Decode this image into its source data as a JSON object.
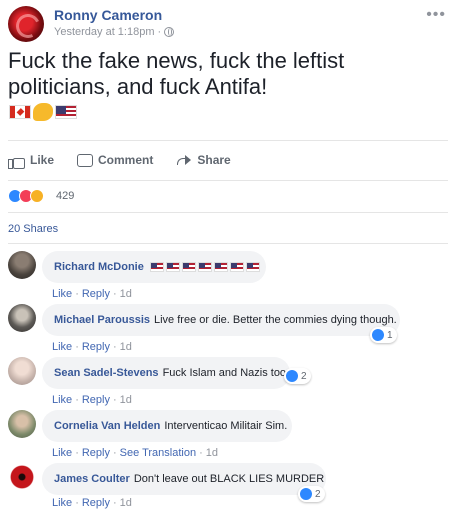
{
  "post": {
    "author": "Ronny Cameron",
    "timestamp": "Yesterday at 1:18pm",
    "meta_separator": "·",
    "text": "Fuck the fake news, fuck the leftist politicians, and fuck Antifa!",
    "emojis": [
      "flag-canada",
      "flexed-biceps",
      "flag-usa"
    ]
  },
  "actions": {
    "like": "Like",
    "comment": "Comment",
    "share": "Share"
  },
  "reactions": {
    "types": [
      "like",
      "love",
      "haha"
    ],
    "count": "429"
  },
  "shares": "20 Shares",
  "comments": [
    {
      "name": "Richard McDonie",
      "text": "",
      "flags": 6,
      "links": {
        "like": "Like",
        "reply": "Reply",
        "time": "1d"
      }
    },
    {
      "name": "Michael Paroussis",
      "text": "Live free or die. Better the commies dying though.",
      "reactions": "1",
      "links": {
        "like": "Like",
        "reply": "Reply",
        "time": "1d"
      }
    },
    {
      "name": "Sean Sadel-Stevens",
      "text": "Fuck Islam and Nazis too",
      "reactions": "2",
      "links": {
        "like": "Like",
        "reply": "Reply",
        "time": "1d"
      }
    },
    {
      "name": "Cornelia Van Helden",
      "text": "Interventicao Militair Sim.",
      "links": {
        "like": "Like",
        "reply": "Reply",
        "translate": "See Translation",
        "time": "1d"
      }
    },
    {
      "name": "James Coulter",
      "text": "Don't leave out BLACK LIES MURDER",
      "reactions": "2",
      "links": {
        "like": "Like",
        "reply": "Reply",
        "time": "1d"
      }
    }
  ],
  "link_separator": "·",
  "icons": {
    "more": "more-options-icon",
    "privacy": "globe-icon"
  }
}
